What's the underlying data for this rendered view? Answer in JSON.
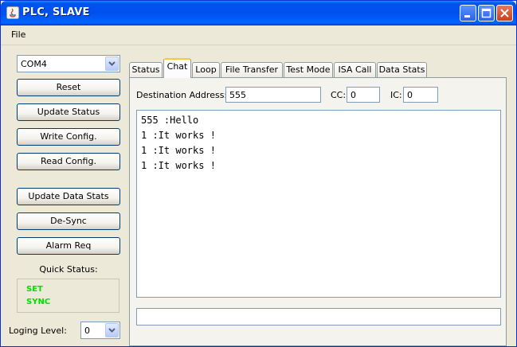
{
  "window": {
    "title": "PLC, SLAVE"
  },
  "menu": {
    "file": "File"
  },
  "port_select": {
    "value": "COM4"
  },
  "buttons": {
    "reset": "Reset",
    "update_status": "Update Status",
    "write_config": "Write Config.",
    "read_config": "Read Config.",
    "update_data_stats": "Update Data Stats",
    "de_sync": "De-Sync",
    "alarm_req": "Alarm Req"
  },
  "quick_status": {
    "label": "Quick Status:",
    "lines": [
      "SET",
      "SYNC"
    ],
    "color": "#00e000"
  },
  "logging": {
    "label": "Loging Level:",
    "value": "0"
  },
  "tabs": [
    "Status",
    "Chat",
    "Loop",
    "File Transfer",
    "Test Mode",
    "ISA Call",
    "Data Stats"
  ],
  "active_tab": "Chat",
  "chat": {
    "destination_label": "Destination Address:",
    "destination_value": "555",
    "cc_label": "CC:",
    "cc_value": "0",
    "ic_label": "IC:",
    "ic_value": "0",
    "messages": [
      "555 :Hello",
      "1 :It works !",
      "1 :It works !",
      "1 :It works !"
    ],
    "input_value": ""
  },
  "colors": {
    "titlebar": "#0053ee",
    "window_bg": "#ece9d8",
    "active_tab_highlight": "#ffc83c"
  }
}
